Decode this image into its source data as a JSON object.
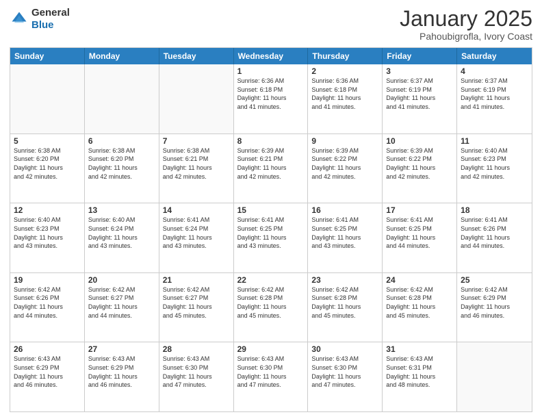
{
  "header": {
    "logo_line1": "General",
    "logo_line2": "Blue",
    "month": "January 2025",
    "location": "Pahoubigrofla, Ivory Coast"
  },
  "days_of_week": [
    "Sunday",
    "Monday",
    "Tuesday",
    "Wednesday",
    "Thursday",
    "Friday",
    "Saturday"
  ],
  "weeks": [
    [
      {
        "day": "",
        "info": ""
      },
      {
        "day": "",
        "info": ""
      },
      {
        "day": "",
        "info": ""
      },
      {
        "day": "1",
        "info": "Sunrise: 6:36 AM\nSunset: 6:18 PM\nDaylight: 11 hours\nand 41 minutes."
      },
      {
        "day": "2",
        "info": "Sunrise: 6:36 AM\nSunset: 6:18 PM\nDaylight: 11 hours\nand 41 minutes."
      },
      {
        "day": "3",
        "info": "Sunrise: 6:37 AM\nSunset: 6:19 PM\nDaylight: 11 hours\nand 41 minutes."
      },
      {
        "day": "4",
        "info": "Sunrise: 6:37 AM\nSunset: 6:19 PM\nDaylight: 11 hours\nand 41 minutes."
      }
    ],
    [
      {
        "day": "5",
        "info": "Sunrise: 6:38 AM\nSunset: 6:20 PM\nDaylight: 11 hours\nand 42 minutes."
      },
      {
        "day": "6",
        "info": "Sunrise: 6:38 AM\nSunset: 6:20 PM\nDaylight: 11 hours\nand 42 minutes."
      },
      {
        "day": "7",
        "info": "Sunrise: 6:38 AM\nSunset: 6:21 PM\nDaylight: 11 hours\nand 42 minutes."
      },
      {
        "day": "8",
        "info": "Sunrise: 6:39 AM\nSunset: 6:21 PM\nDaylight: 11 hours\nand 42 minutes."
      },
      {
        "day": "9",
        "info": "Sunrise: 6:39 AM\nSunset: 6:22 PM\nDaylight: 11 hours\nand 42 minutes."
      },
      {
        "day": "10",
        "info": "Sunrise: 6:39 AM\nSunset: 6:22 PM\nDaylight: 11 hours\nand 42 minutes."
      },
      {
        "day": "11",
        "info": "Sunrise: 6:40 AM\nSunset: 6:23 PM\nDaylight: 11 hours\nand 42 minutes."
      }
    ],
    [
      {
        "day": "12",
        "info": "Sunrise: 6:40 AM\nSunset: 6:23 PM\nDaylight: 11 hours\nand 43 minutes."
      },
      {
        "day": "13",
        "info": "Sunrise: 6:40 AM\nSunset: 6:24 PM\nDaylight: 11 hours\nand 43 minutes."
      },
      {
        "day": "14",
        "info": "Sunrise: 6:41 AM\nSunset: 6:24 PM\nDaylight: 11 hours\nand 43 minutes."
      },
      {
        "day": "15",
        "info": "Sunrise: 6:41 AM\nSunset: 6:25 PM\nDaylight: 11 hours\nand 43 minutes."
      },
      {
        "day": "16",
        "info": "Sunrise: 6:41 AM\nSunset: 6:25 PM\nDaylight: 11 hours\nand 43 minutes."
      },
      {
        "day": "17",
        "info": "Sunrise: 6:41 AM\nSunset: 6:25 PM\nDaylight: 11 hours\nand 44 minutes."
      },
      {
        "day": "18",
        "info": "Sunrise: 6:41 AM\nSunset: 6:26 PM\nDaylight: 11 hours\nand 44 minutes."
      }
    ],
    [
      {
        "day": "19",
        "info": "Sunrise: 6:42 AM\nSunset: 6:26 PM\nDaylight: 11 hours\nand 44 minutes."
      },
      {
        "day": "20",
        "info": "Sunrise: 6:42 AM\nSunset: 6:27 PM\nDaylight: 11 hours\nand 44 minutes."
      },
      {
        "day": "21",
        "info": "Sunrise: 6:42 AM\nSunset: 6:27 PM\nDaylight: 11 hours\nand 45 minutes."
      },
      {
        "day": "22",
        "info": "Sunrise: 6:42 AM\nSunset: 6:28 PM\nDaylight: 11 hours\nand 45 minutes."
      },
      {
        "day": "23",
        "info": "Sunrise: 6:42 AM\nSunset: 6:28 PM\nDaylight: 11 hours\nand 45 minutes."
      },
      {
        "day": "24",
        "info": "Sunrise: 6:42 AM\nSunset: 6:28 PM\nDaylight: 11 hours\nand 45 minutes."
      },
      {
        "day": "25",
        "info": "Sunrise: 6:42 AM\nSunset: 6:29 PM\nDaylight: 11 hours\nand 46 minutes."
      }
    ],
    [
      {
        "day": "26",
        "info": "Sunrise: 6:43 AM\nSunset: 6:29 PM\nDaylight: 11 hours\nand 46 minutes."
      },
      {
        "day": "27",
        "info": "Sunrise: 6:43 AM\nSunset: 6:29 PM\nDaylight: 11 hours\nand 46 minutes."
      },
      {
        "day": "28",
        "info": "Sunrise: 6:43 AM\nSunset: 6:30 PM\nDaylight: 11 hours\nand 47 minutes."
      },
      {
        "day": "29",
        "info": "Sunrise: 6:43 AM\nSunset: 6:30 PM\nDaylight: 11 hours\nand 47 minutes."
      },
      {
        "day": "30",
        "info": "Sunrise: 6:43 AM\nSunset: 6:30 PM\nDaylight: 11 hours\nand 47 minutes."
      },
      {
        "day": "31",
        "info": "Sunrise: 6:43 AM\nSunset: 6:31 PM\nDaylight: 11 hours\nand 48 minutes."
      },
      {
        "day": "",
        "info": ""
      }
    ]
  ]
}
